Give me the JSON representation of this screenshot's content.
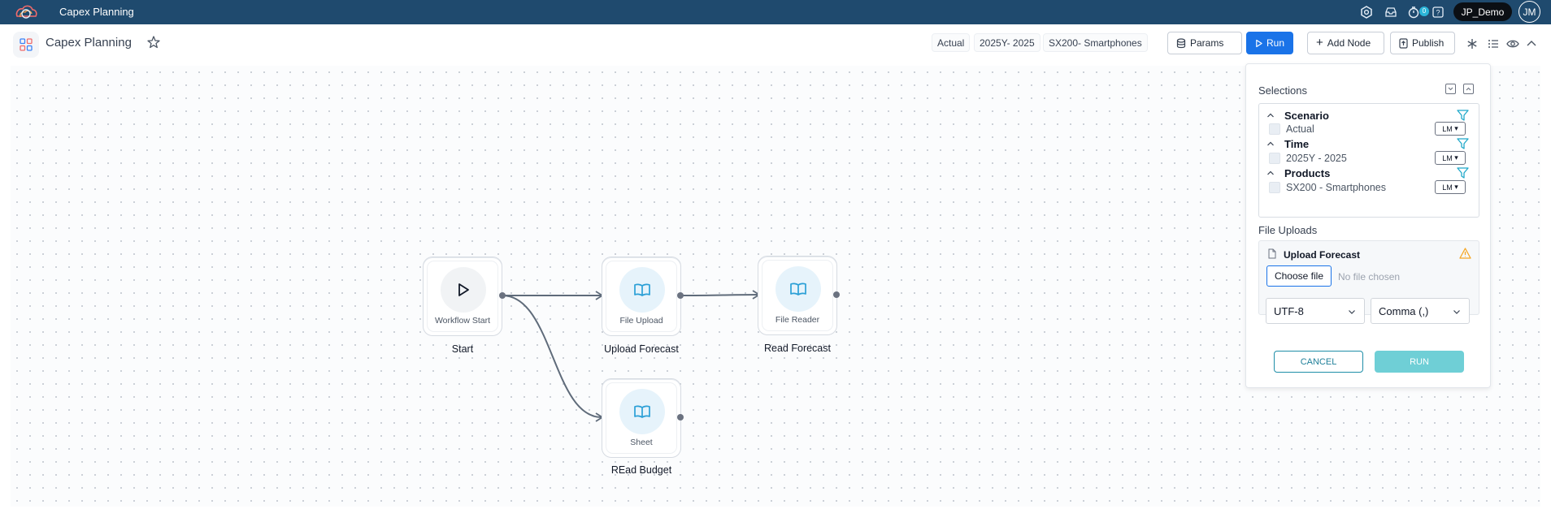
{
  "header": {
    "app_name": "Capex Planning",
    "notification_count": "0",
    "user_name": "JP_Demo",
    "avatar_initials": "JM"
  },
  "toolbar": {
    "page_title": "Capex Planning",
    "chips": [
      "Actual",
      "2025Y- 2025",
      "SX200- Smartphones"
    ],
    "params_label": "Params",
    "run_label": "Run",
    "add_node_label": "Add Node",
    "publish_label": "Publish"
  },
  "nodes": {
    "start": {
      "label": "Workflow Start",
      "title": "Start"
    },
    "upload": {
      "label": "File Upload",
      "title": "Upload Forecast"
    },
    "reader": {
      "label": "File Reader",
      "title": "Read Forecast"
    },
    "sheet": {
      "label": "Sheet",
      "title": "REad Budget"
    }
  },
  "panel": {
    "selections_title": "Selections",
    "groups": [
      {
        "name": "Scenario",
        "item": "Actual",
        "mode": "LM"
      },
      {
        "name": "Time",
        "item": "2025Y - 2025",
        "mode": "LM"
      },
      {
        "name": "Products",
        "item": "SX200 - Smartphones",
        "mode": "LM"
      }
    ],
    "file_uploads_title": "File Uploads",
    "upload_name": "Upload Forecast",
    "choose_file_label": "Choose file",
    "no_file_text": "No file chosen",
    "encoding": "UTF-8",
    "delimiter": "Comma (,)",
    "cancel_label": "CANCEL",
    "run_label": "RUN"
  },
  "colors": {
    "topbar": "#1f4a6e",
    "primary": "#1a73e8",
    "teal": "#1f8ea8",
    "run_disabled": "#6fcfd6",
    "node_icon": "#2a9fd6"
  }
}
